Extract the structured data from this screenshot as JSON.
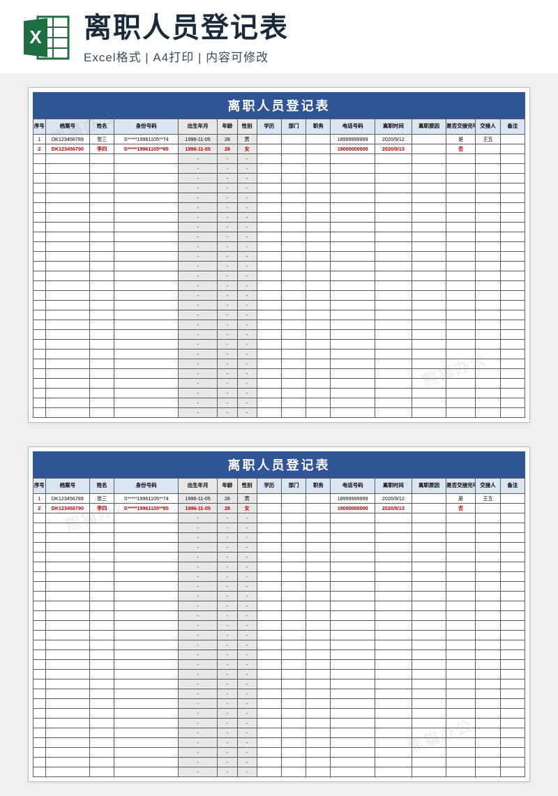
{
  "header": {
    "title": "离职人员登记表",
    "subtitle": "Excel格式 | A4打印 | 内容可修改",
    "icon_name": "excel-icon"
  },
  "sheet": {
    "title": "离职人员登记表",
    "columns": [
      "序号",
      "档案号",
      "姓名",
      "身份号码",
      "出生年月",
      "年龄",
      "性别",
      "学历",
      "部门",
      "职务",
      "电话号码",
      "离职时间",
      "离职原因",
      "是否交接完毕",
      "交接人",
      "备注"
    ],
    "rows": [
      {
        "seq": "1",
        "file": "DK123456789",
        "name": "张三",
        "id": "S*****19961105**74",
        "birth": "1996-11-05",
        "age": "28",
        "sex": "男",
        "edu": "",
        "dept": "",
        "job": "",
        "phone": "18999999999",
        "leave_date": "2020/9/12",
        "reason": "",
        "handed": "是",
        "handover": "王五",
        "remark": "",
        "highlight": false
      },
      {
        "seq": "2",
        "file": "DK123456790",
        "name": "李四",
        "id": "S*****19961105**85",
        "birth": "1996-11-05",
        "age": "28",
        "sex": "女",
        "edu": "",
        "dept": "",
        "job": "",
        "phone": "19000000000",
        "leave_date": "2020/9/13",
        "reason": "",
        "handed": "否",
        "handover": "",
        "remark": "",
        "highlight": true
      }
    ],
    "empty_placeholder": "-",
    "empty_row_count": 27
  },
  "watermark": "熊猫办公"
}
